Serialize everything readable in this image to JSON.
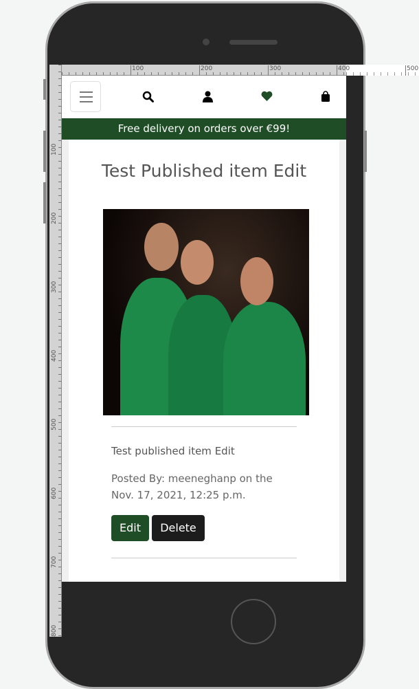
{
  "ruler": {
    "horizontal_labels": [
      "100",
      "200",
      "300",
      "400",
      "500"
    ],
    "vertical_labels": [
      "100",
      "200",
      "300",
      "400",
      "500",
      "600",
      "700",
      "800"
    ]
  },
  "header": {
    "icons": [
      "hamburger-icon",
      "search-icon",
      "user-icon",
      "heart-icon",
      "shopping-bag-icon"
    ],
    "heart_color": "#1f4d26"
  },
  "banner": {
    "text": "Free delivery on orders over €99!",
    "color": "#1f4d26"
  },
  "post": {
    "title": "Test Published item Edit",
    "body": "Test published item Edit",
    "meta_line1": "Posted By: meeneghanp on the",
    "meta_line2": "Nov. 17, 2021, 12:25 p.m.",
    "edit_label": "Edit",
    "delete_label": "Delete"
  }
}
